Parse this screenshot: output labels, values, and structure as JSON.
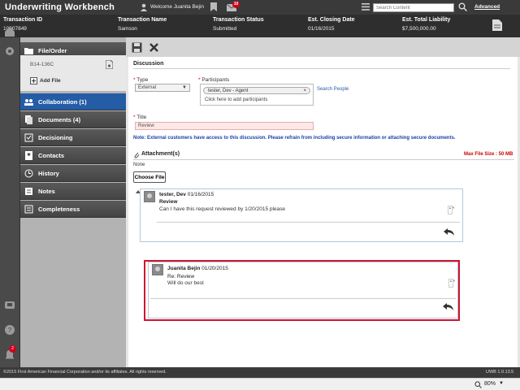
{
  "app": {
    "title": "Underwriting Workbench"
  },
  "topbar": {
    "welcome": "Welcome Juanita Bejin",
    "mail_count": "10",
    "search_placeholder": "Search Content",
    "advanced_label": "Advanced"
  },
  "transaction": {
    "columns": [
      {
        "label": "Transaction ID",
        "value": "10007849"
      },
      {
        "label": "Transaction Name",
        "value": "Samson"
      },
      {
        "label": "Transaction Status",
        "value": "Submitted"
      },
      {
        "label": "Est. Closing Date",
        "value": "01/16/2015"
      },
      {
        "label": "Est. Total Liability",
        "value": "$7,500,000.00"
      }
    ]
  },
  "rail": {
    "notification_count": "2"
  },
  "sidebar": {
    "file_order_label": "File/Order",
    "order_code": "B14-136C",
    "add_file_label": "Add File",
    "items": [
      {
        "label": "Collaboration (1)",
        "icon": "collaboration-icon",
        "active": true
      },
      {
        "label": "Documents (4)",
        "icon": "documents-icon"
      },
      {
        "label": "Decisioning",
        "icon": "decisioning-icon"
      },
      {
        "label": "Contacts",
        "icon": "contacts-icon"
      },
      {
        "label": "History",
        "icon": "history-icon"
      },
      {
        "label": "Notes",
        "icon": "notes-icon"
      },
      {
        "label": "Completeness",
        "icon": "completeness-icon"
      }
    ]
  },
  "discussion": {
    "heading": "Discussion",
    "type_label": "Type",
    "type_value": "External",
    "participants_label": "Participants",
    "participant_tag": "tester, Dev - Agent",
    "participant_remove": "×",
    "participants_hint": "Click here to add participants",
    "search_people": "Search People",
    "title_label": "Title",
    "title_value": "Review",
    "note": "Note: External customers have access to this discussion. Please refrain from including secure information or attaching secure documents.",
    "attachments_label": "Attachment(s)",
    "max_file_size": "Max File Size : 50 MB",
    "attachments_value": "None",
    "choose_file_label": "Choose File"
  },
  "comments": [
    {
      "author": "tester, Dev",
      "date": "01/16/2015",
      "subject": "Review",
      "text": "Can I have this request reviewed by 1/20/2015 please"
    },
    {
      "author": "Juanita Bejin",
      "date": "01/20/2015",
      "subject": "Re: Review",
      "text": "Will do our best"
    }
  ],
  "footer": {
    "copyright": "©2015 First American Financial Corporation and/or its affiliates. All rights reserved.",
    "version": "UWB 1.0.13.5"
  },
  "statusbar": {
    "zoom": "80%",
    "zoom_dropdown": "▼"
  },
  "colors": {
    "accent": "#245ca6",
    "highlight": "#d0142c",
    "header_bg": "#2e2e2e"
  }
}
